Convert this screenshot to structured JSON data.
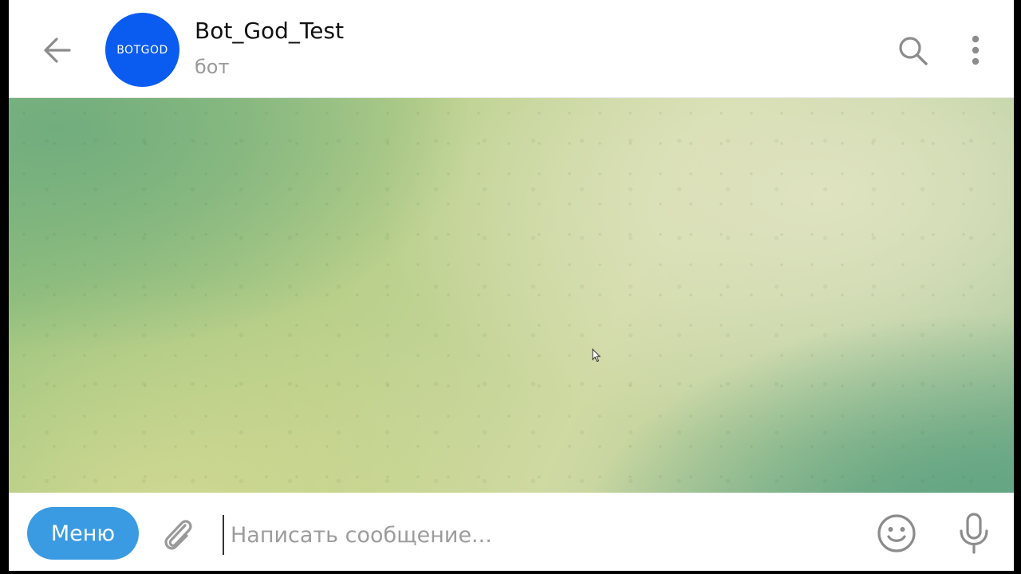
{
  "header": {
    "title": "Bot_God_Test",
    "subtitle": "бот",
    "avatar_text": "BOTGOD",
    "avatar_color": "#0a5cf0",
    "icons": [
      "arrow-left-icon",
      "search-icon",
      "more-vertical-icon"
    ]
  },
  "composer": {
    "menu_label": "Меню",
    "menu_color": "#3a9be2",
    "placeholder": "Написать сообщение...",
    "input_value": "",
    "icons": [
      "paperclip-icon",
      "smile-icon",
      "microphone-icon"
    ]
  },
  "chat": {
    "messages": []
  }
}
